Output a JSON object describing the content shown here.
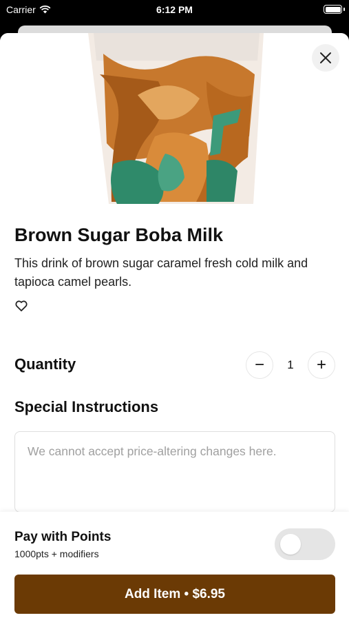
{
  "status_bar": {
    "carrier": "Carrier",
    "time": "6:12 PM"
  },
  "product": {
    "name": "Brown Sugar Boba Milk",
    "description": "This drink of brown sugar caramel fresh cold milk and tapioca camel pearls."
  },
  "quantity": {
    "label": "Quantity",
    "value": "1",
    "minus": "−",
    "plus": "+"
  },
  "special_instructions": {
    "label": "Special Instructions",
    "placeholder": "We cannot accept price-altering changes here."
  },
  "pay_with_points": {
    "label": "Pay with Points",
    "sublabel": "1000pts + modifiers",
    "enabled": false
  },
  "add_button": {
    "label": "Add Item • $6.95"
  },
  "colors": {
    "accent": "#6b3a05"
  },
  "icons": [
    "wifi-icon",
    "battery-icon",
    "close-icon",
    "heart-icon"
  ]
}
